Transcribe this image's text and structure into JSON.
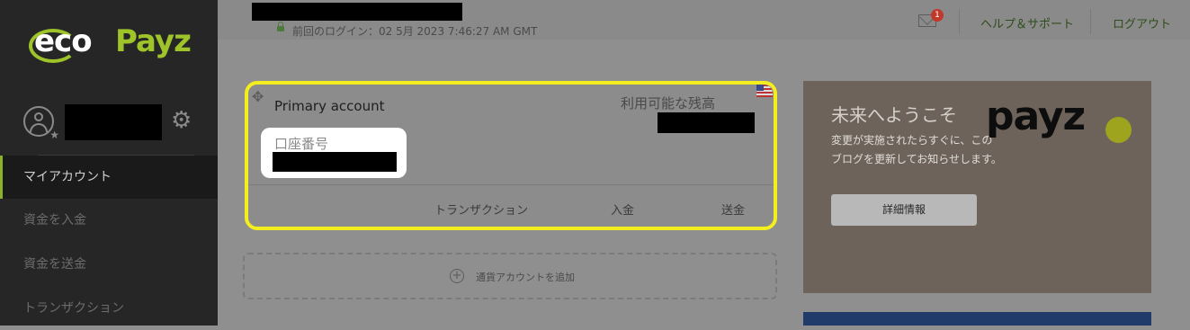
{
  "brand": {
    "eco": "eco",
    "payz": "Payz"
  },
  "sidebar": {
    "items": [
      {
        "label": "マイアカウント",
        "active": true
      },
      {
        "label": "資金を入金"
      },
      {
        "label": "資金を送金"
      },
      {
        "label": "トランザクション"
      }
    ]
  },
  "header": {
    "last_login": "前回のログイン：02 5月 2023 7:46:27 AM GMT",
    "notification_count": "1",
    "help_label": "ヘルプ＆サポート",
    "logout_label": "ログアウト"
  },
  "account": {
    "title": "Primary account",
    "balance_label": "利用可能な残高",
    "account_number_label": "口座番号",
    "actions": [
      "トランザクション",
      "入金",
      "送金"
    ]
  },
  "add_currency": {
    "label": "通貨アカウントを追加"
  },
  "promo": {
    "title": "未来へようこそ",
    "text": "変更が実施されたらすぐに、このブログを更新してお知らせします。",
    "brand": "payz",
    "button_label": "詳細情報"
  },
  "colors": {
    "accent": "#9ec42a",
    "highlight": "#f5ee1f",
    "badge": "#c0392b"
  }
}
